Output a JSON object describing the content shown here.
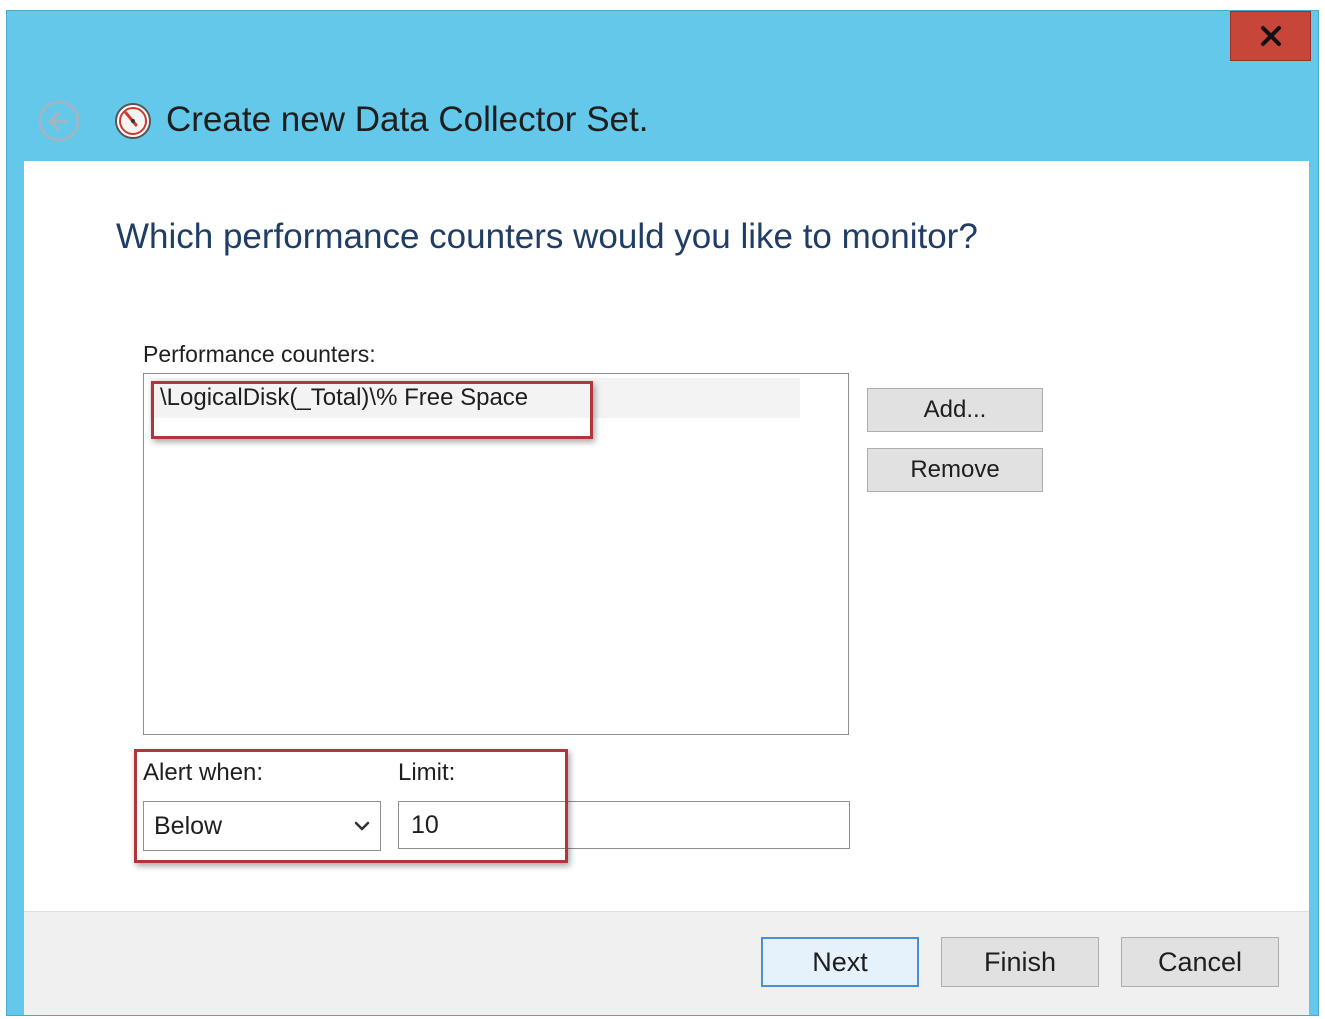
{
  "window": {
    "title": "Create new Data Collector Set.",
    "close_label": "x"
  },
  "page": {
    "question": "Which performance counters would you like to monitor?"
  },
  "counters": {
    "label": "Performance counters:",
    "items": [
      "\\LogicalDisk(_Total)\\% Free Space"
    ],
    "add_label": "Add...",
    "remove_label": "Remove"
  },
  "alert": {
    "when_label": "Alert when:",
    "when_value": "Below",
    "limit_label": "Limit:",
    "limit_value": "10"
  },
  "footer": {
    "next_label": "Next",
    "finish_label": "Finish",
    "cancel_label": "Cancel"
  },
  "icons": {
    "back": "back-arrow-icon",
    "app": "performance-monitor-icon",
    "close": "close-icon",
    "dropdown": "chevron-down-icon"
  },
  "colors": {
    "titlebar": "#64c8ea",
    "close_button": "#c8453a",
    "highlight_box": "#b0363c",
    "question_text": "#1f3d66"
  }
}
